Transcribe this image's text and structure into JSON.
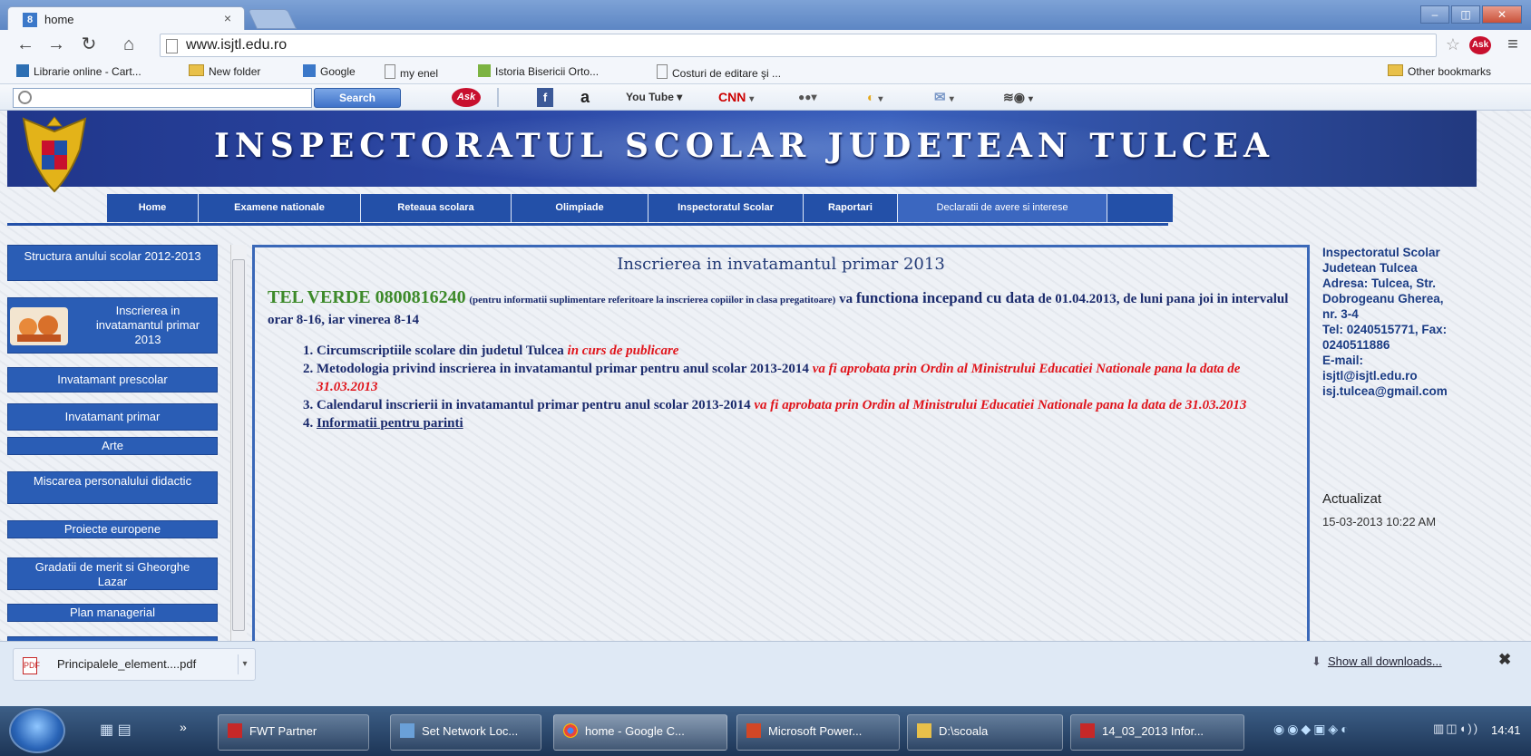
{
  "browser": {
    "tab_title": "home",
    "tab_close": "×",
    "url": "www.isjtl.edu.ro",
    "window_controls": [
      "–",
      "◫",
      "✕"
    ],
    "bookmarks": [
      {
        "label": "Librarie online - Cart...",
        "icon": "site-icon"
      },
      {
        "label": "New folder",
        "icon": "folder-icon"
      },
      {
        "label": "Google",
        "icon": "google-icon"
      },
      {
        "label": "my enel",
        "icon": "page-icon"
      },
      {
        "label": "Istoria Bisericii Orto...",
        "icon": "site-icon"
      },
      {
        "label": "Costuri de editare şi ...",
        "icon": "page-icon"
      }
    ],
    "other_bookmarks": "Other bookmarks"
  },
  "ask_toolbar": {
    "search_button": "Search",
    "ask_logo": "Ask",
    "icons": [
      "facebook-icon",
      "amazon-icon",
      "youtube-icon",
      "cnn-icon",
      "weather-icon",
      "mail-icon",
      "radio-icon"
    ],
    "amazon": "a",
    "youtube": "You Tube",
    "cnn": "CNN"
  },
  "site": {
    "banner_title": "INSPECTORATUL SCOLAR JUDETEAN TULCEA",
    "menu": [
      "Home",
      "Examene nationale",
      "Reteaua scolara",
      "Olimpiade",
      "Inspectoratul Scolar",
      "Raportari",
      "Declaratii de avere si interese"
    ],
    "sidebar": [
      "Structura anului scolar 2012-2013",
      "Inscrierea in invatamantul primar 2013",
      "Invatamant prescolar",
      "Invatamant primar",
      "Arte",
      "Miscarea personalului didactic",
      "Proiecte europene",
      "Gradatii de merit si Gheorghe Lazar",
      "Plan managerial"
    ],
    "main": {
      "title": "Inscrierea in invatamantul primar 2013",
      "tel_verde": "TEL VERDE 0800816240",
      "tel_note": "(pentru informatii suplimentare referitoare la inscrierea copiilor in clasa pregatitoare)",
      "tel_text_1": " va ",
      "tel_text_2": "functiona incepand cu data",
      "tel_text_3": " de 01.04.2013, de luni pana joi in intervalul orar 8-16, iar vinerea 8-14",
      "items": [
        {
          "text": "Circumscriptiile scolare din judetul Tulcea ",
          "note": "in curs de publicare"
        },
        {
          "text": "Metodologia privind inscrierea in invatamantul primar pentru anul scolar 2013-2014 ",
          "note": "va fi aprobata prin Ordin al Ministrului Educatiei Nationale pana la data de 31.03.2013"
        },
        {
          "text": "Calendarul inscrierii in invatamantul primar pentru anul scolar 2013-2014 ",
          "note": "va fi aprobata prin Ordin al Ministrului Educatiei Nationale pana la data de 31.03.2013"
        },
        {
          "link": "Informatii pentru parinti"
        }
      ]
    },
    "contact": [
      "Inspectoratul Scolar",
      "Judetean Tulcea",
      "Adresa: Tulcea, Str.",
      "Dobrogeanu Gherea,",
      "nr. 3-4",
      "Tel: 0240515771, Fax:",
      "0240511886",
      "E-mail:",
      "isjtl@isjtl.edu.ro",
      "isj.tulcea@gmail.com"
    ],
    "updated_label": "Actualizat",
    "updated_date": "15-03-2013 10:22 AM"
  },
  "downloads": {
    "file": "Principalele_element....pdf",
    "show_all": "Show all downloads...",
    "close": "✖"
  },
  "taskbar": {
    "tasks": [
      "FWT Partner",
      "Set Network Loc...",
      "home - Google C...",
      "Microsoft Power...",
      "D:\\scoala",
      "14_03_2013 Infor..."
    ],
    "clock": "14:41"
  }
}
